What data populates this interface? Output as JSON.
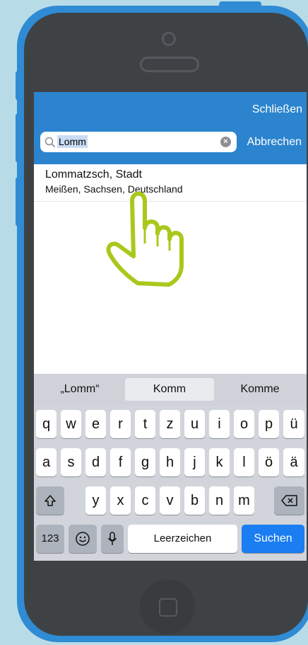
{
  "header": {
    "close_label": "Schließen",
    "cancel_label": "Abbrechen"
  },
  "search": {
    "value": "Lomm"
  },
  "results": [
    {
      "title": "Lommatzsch, Stadt",
      "subtitle": "Meißen, Sachsen, Deutschland"
    }
  ],
  "keyboard": {
    "suggestions": [
      "„Lomm“",
      "Komm",
      "Komme"
    ],
    "row1": [
      "q",
      "w",
      "e",
      "r",
      "t",
      "z",
      "u",
      "i",
      "o",
      "p",
      "ü"
    ],
    "row2": [
      "a",
      "s",
      "d",
      "f",
      "g",
      "h",
      "j",
      "k",
      "l",
      "ö",
      "ä"
    ],
    "row3": [
      "y",
      "x",
      "c",
      "v",
      "b",
      "n",
      "m"
    ],
    "numbers_label": "123",
    "space_label": "Leerzeichen",
    "search_label": "Suchen"
  },
  "colors": {
    "background": "#b7dce8",
    "phone_frame": "#2f8bd3",
    "nav_bar": "#2b84cd",
    "search_key": "#1a7df2",
    "finger_outline": "#a8c91c"
  },
  "icons": {
    "shift": "shift-icon",
    "backspace": "backspace-icon",
    "emoji": "emoji-icon",
    "microphone": "microphone-icon",
    "search": "search-icon",
    "clear": "clear-icon",
    "finger": "pointing-finger-icon"
  }
}
